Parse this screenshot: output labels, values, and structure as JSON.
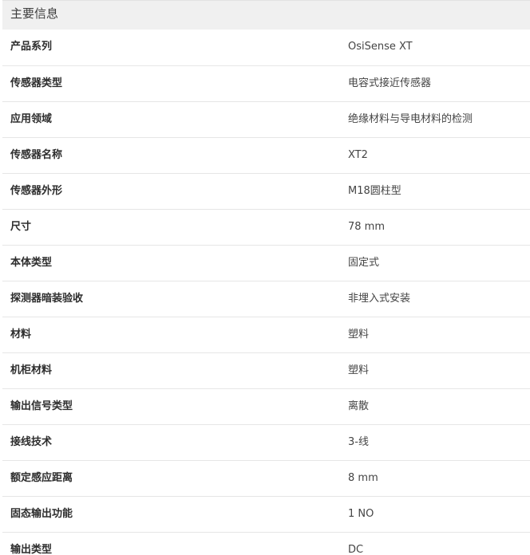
{
  "section": {
    "title": "主要信息"
  },
  "rows": [
    {
      "label": "产品系列",
      "value": "OsiSense XT"
    },
    {
      "label": "传感器类型",
      "value": "电容式接近传感器"
    },
    {
      "label": "应用领域",
      "value": "绝缘材料与导电材料的检测"
    },
    {
      "label": "传感器名称",
      "value": "XT2"
    },
    {
      "label": "传感器外形",
      "value": "M18圆柱型"
    },
    {
      "label": "尺寸",
      "value": "78 mm"
    },
    {
      "label": "本体类型",
      "value": "固定式"
    },
    {
      "label": "探测器暗装验收",
      "value": "非埋入式安装"
    },
    {
      "label": "材料",
      "value": "塑料"
    },
    {
      "label": "机柜材料",
      "value": "塑料"
    },
    {
      "label": "输出信号类型",
      "value": "离散"
    },
    {
      "label": "接线技术",
      "value": "3-线"
    },
    {
      "label": "额定感应距离",
      "value": "8 mm"
    },
    {
      "label": "固态输出功能",
      "value": "1 NO"
    },
    {
      "label": "输出类型",
      "value": "DC"
    }
  ]
}
